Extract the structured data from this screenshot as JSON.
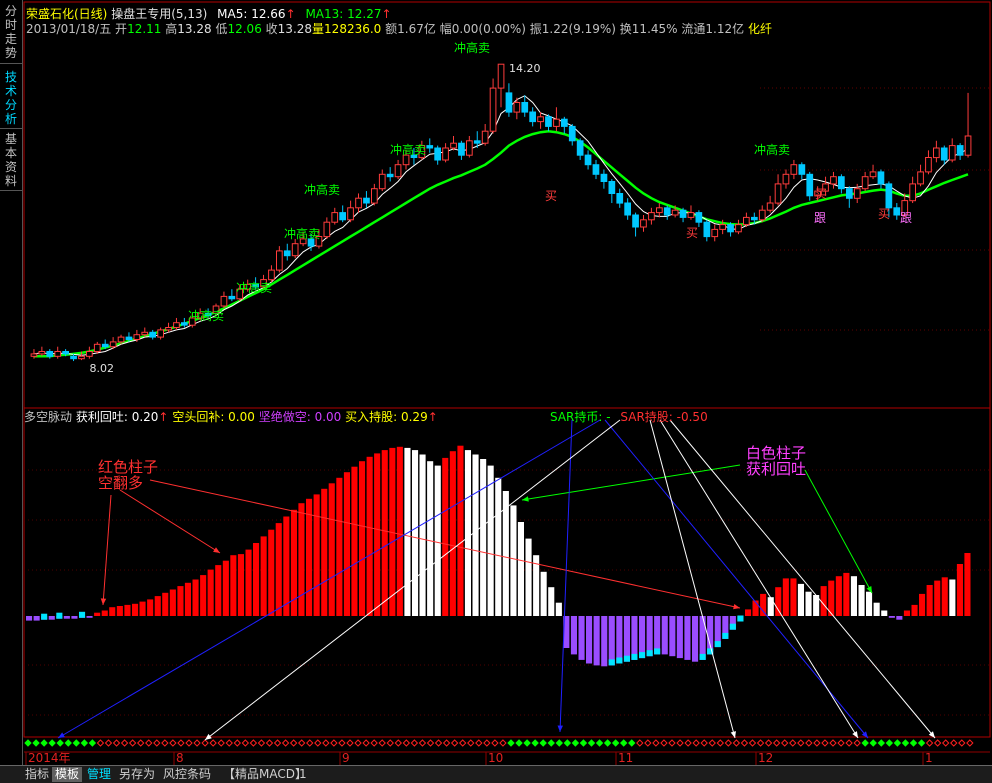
{
  "sidebar": {
    "tabs": [
      {
        "chars": [
          "分",
          "时",
          "走",
          "势"
        ],
        "active": false
      },
      {
        "chars": [
          "技",
          "术",
          "分",
          "析"
        ],
        "active": true
      },
      {
        "chars": [
          "基",
          "本",
          "资",
          "料"
        ],
        "active": false
      }
    ]
  },
  "header": {
    "stock": "荣盛石化(日线)",
    "strategy": "操盘王专用",
    "params": "(5,13)",
    "ma5": "MA5: 12.66",
    "ma13": "MA13: 12.27",
    "arrow": "↑"
  },
  "quote": {
    "date": "2013/01/18/五",
    "open_label": "开",
    "open": "12.11",
    "high_label": "高",
    "high": "13.28",
    "low_label": "低",
    "low": "12.06",
    "close_label": "收",
    "close": "13.28",
    "vol_label": "量",
    "vol": "128236.0",
    "amount": "额1.67亿",
    "change": "幅0.00(0.00%)",
    "amplitude": "振1.22(9.19%)",
    "turnover": "换11.45%",
    "float": "流通1.12亿",
    "industry": "化纤"
  },
  "indicator": {
    "name": "多空脉动",
    "profit_back": "获利回吐: 0.20",
    "short_cover": "空头回补: 0.00",
    "short_sell": "坚绝做空: 0.00",
    "buy_hold": "买入持股: 0.29",
    "arrow": "↑",
    "sar_coin": "SAR持币: -",
    "sar_hold": "SAR持股: -0.50"
  },
  "annotations": {
    "red_bar_line1": "红色柱子",
    "red_bar_line2": "空翻多",
    "white_bar_line1": "白色柱子",
    "white_bar_line2": "获利回吐"
  },
  "bottom_tabs": [
    "指标",
    "模板",
    "管理",
    "另存为",
    "风控条码",
    "【精品MACD】",
    "1"
  ],
  "colors": {
    "up": "#ff3c3c",
    "down": "#00c8ff",
    "ma5": "#ffffff",
    "ma13": "#00ff00",
    "signal_sell": "#00ff00",
    "signal_buy": "#ff3c3c",
    "axis": "#b00000",
    "hist_red": "#ff0000",
    "hist_white": "#ffffff",
    "hist_violet": "#9a4dff",
    "hist_cyan": "#00e5ff"
  },
  "chart_data": {
    "type": "candlestick+histogram",
    "price_ylim": [
      7.5,
      14.6
    ],
    "date_labels": [
      "2014年",
      "8",
      "9",
      "10",
      "11",
      "12",
      "1"
    ],
    "price_labels": [
      {
        "text": "14.20",
        "value": 14.2
      },
      {
        "text": "8.02",
        "value": 8.02
      }
    ],
    "candles": [
      [
        8.1,
        8.15,
        8.25,
        8.05
      ],
      [
        8.15,
        8.2,
        8.3,
        8.1
      ],
      [
        8.2,
        8.1,
        8.25,
        8.05
      ],
      [
        8.1,
        8.2,
        8.3,
        8.05
      ],
      [
        8.2,
        8.15,
        8.25,
        8.1
      ],
      [
        8.1,
        8.05,
        8.15,
        8.0
      ],
      [
        8.05,
        8.1,
        8.2,
        8.02
      ],
      [
        8.1,
        8.2,
        8.3,
        8.05
      ],
      [
        8.2,
        8.35,
        8.4,
        8.15
      ],
      [
        8.35,
        8.3,
        8.45,
        8.25
      ],
      [
        8.3,
        8.4,
        8.5,
        8.25
      ],
      [
        8.4,
        8.5,
        8.55,
        8.35
      ],
      [
        8.5,
        8.45,
        8.6,
        8.4
      ],
      [
        8.45,
        8.55,
        8.65,
        8.4
      ],
      [
        8.55,
        8.6,
        8.7,
        8.5
      ],
      [
        8.6,
        8.5,
        8.65,
        8.45
      ],
      [
        8.5,
        8.65,
        8.7,
        8.45
      ],
      [
        8.65,
        8.7,
        8.8,
        8.6
      ],
      [
        8.7,
        8.8,
        8.9,
        8.65
      ],
      [
        8.8,
        8.75,
        8.9,
        8.7
      ],
      [
        8.75,
        8.9,
        9.0,
        8.7
      ],
      [
        8.9,
        9.0,
        9.1,
        8.85
      ],
      [
        9.0,
        8.95,
        9.1,
        8.9
      ],
      [
        9.0,
        9.15,
        9.2,
        8.95
      ],
      [
        9.15,
        9.35,
        9.45,
        9.1
      ],
      [
        9.35,
        9.3,
        9.5,
        9.25
      ],
      [
        9.3,
        9.5,
        9.6,
        9.25
      ],
      [
        9.5,
        9.6,
        9.7,
        9.45
      ],
      [
        9.6,
        9.55,
        9.75,
        9.5
      ],
      [
        9.55,
        9.7,
        9.8,
        9.5
      ],
      [
        9.7,
        9.9,
        10.0,
        9.65
      ],
      [
        9.9,
        10.3,
        10.4,
        9.85
      ],
      [
        10.3,
        10.2,
        10.45,
        10.1
      ],
      [
        10.2,
        10.45,
        10.55,
        10.15
      ],
      [
        10.45,
        10.55,
        10.7,
        10.4
      ],
      [
        10.55,
        10.4,
        10.65,
        10.3
      ],
      [
        10.4,
        10.6,
        10.75,
        10.35
      ],
      [
        10.6,
        10.9,
        11.0,
        10.55
      ],
      [
        10.9,
        11.1,
        11.2,
        10.85
      ],
      [
        11.1,
        10.95,
        11.25,
        10.9
      ],
      [
        10.95,
        11.2,
        11.35,
        10.9
      ],
      [
        11.2,
        11.4,
        11.5,
        11.1
      ],
      [
        11.4,
        11.3,
        11.55,
        11.2
      ],
      [
        11.3,
        11.6,
        11.7,
        11.25
      ],
      [
        11.6,
        11.9,
        12.0,
        11.55
      ],
      [
        11.9,
        11.85,
        12.05,
        11.75
      ],
      [
        11.85,
        12.1,
        12.2,
        11.8
      ],
      [
        12.1,
        12.3,
        12.4,
        12.0
      ],
      [
        12.3,
        12.25,
        12.45,
        12.1
      ],
      [
        12.25,
        12.5,
        12.6,
        12.2
      ],
      [
        12.5,
        12.45,
        12.65,
        12.35
      ],
      [
        12.45,
        12.2,
        12.5,
        12.1
      ],
      [
        12.2,
        12.45,
        12.55,
        12.15
      ],
      [
        12.45,
        12.55,
        12.7,
        12.4
      ],
      [
        12.55,
        12.3,
        12.6,
        12.2
      ],
      [
        12.3,
        12.6,
        12.7,
        12.25
      ],
      [
        12.6,
        12.55,
        12.8,
        12.45
      ],
      [
        12.55,
        12.8,
        12.95,
        12.5
      ],
      [
        12.8,
        13.7,
        13.9,
        12.75
      ],
      [
        13.7,
        14.2,
        14.2,
        13.3
      ],
      [
        13.6,
        13.2,
        13.8,
        13.1
      ],
      [
        13.2,
        13.4,
        13.5,
        13.05
      ],
      [
        13.4,
        13.2,
        13.55,
        13.1
      ],
      [
        13.2,
        13.0,
        13.3,
        12.9
      ],
      [
        13.0,
        13.1,
        13.2,
        12.85
      ],
      [
        13.1,
        12.9,
        13.15,
        12.8
      ],
      [
        12.9,
        13.05,
        13.3,
        12.8
      ],
      [
        13.05,
        12.9,
        13.1,
        12.75
      ],
      [
        12.9,
        12.6,
        12.95,
        12.5
      ],
      [
        12.6,
        12.3,
        12.65,
        12.2
      ],
      [
        12.3,
        12.1,
        12.4,
        12.0
      ],
      [
        12.1,
        11.9,
        12.2,
        11.8
      ],
      [
        11.9,
        11.75,
        12.0,
        11.6
      ],
      [
        11.75,
        11.5,
        11.8,
        11.3
      ],
      [
        11.5,
        11.3,
        11.6,
        11.2
      ],
      [
        11.3,
        11.05,
        11.4,
        10.95
      ],
      [
        11.05,
        10.8,
        11.1,
        10.6
      ],
      [
        10.8,
        10.95,
        11.05,
        10.7
      ],
      [
        10.95,
        11.1,
        11.2,
        10.85
      ],
      [
        11.1,
        11.2,
        11.3,
        11.0
      ],
      [
        11.2,
        11.05,
        11.25,
        10.95
      ],
      [
        11.05,
        11.15,
        11.25,
        11.0
      ],
      [
        11.15,
        11.0,
        11.2,
        10.9
      ],
      [
        11.0,
        11.1,
        11.25,
        10.95
      ],
      [
        11.1,
        10.9,
        11.15,
        10.8
      ],
      [
        10.9,
        10.6,
        10.95,
        10.5
      ],
      [
        10.6,
        10.75,
        10.85,
        10.5
      ],
      [
        10.75,
        10.85,
        10.95,
        10.65
      ],
      [
        10.85,
        10.7,
        10.9,
        10.6
      ],
      [
        10.7,
        10.85,
        10.95,
        10.65
      ],
      [
        10.85,
        11.0,
        11.1,
        10.8
      ],
      [
        11.0,
        10.95,
        11.1,
        10.85
      ],
      [
        10.95,
        11.15,
        11.25,
        10.9
      ],
      [
        11.15,
        11.3,
        11.45,
        11.1
      ],
      [
        11.3,
        11.7,
        11.9,
        11.25
      ],
      [
        11.7,
        11.9,
        12.0,
        11.6
      ],
      [
        11.9,
        12.1,
        12.2,
        11.8
      ],
      [
        12.1,
        11.9,
        12.15,
        11.8
      ],
      [
        11.9,
        11.45,
        11.95,
        11.35
      ],
      [
        11.45,
        11.55,
        11.65,
        11.35
      ],
      [
        11.55,
        11.7,
        11.85,
        11.45
      ],
      [
        11.7,
        11.85,
        11.95,
        11.6
      ],
      [
        11.85,
        11.6,
        11.9,
        11.5
      ],
      [
        11.6,
        11.4,
        11.65,
        11.2
      ],
      [
        11.4,
        11.6,
        11.7,
        11.3
      ],
      [
        11.6,
        11.85,
        11.95,
        11.55
      ],
      [
        11.85,
        11.95,
        12.1,
        11.8
      ],
      [
        11.95,
        11.7,
        12.0,
        11.6
      ],
      [
        11.7,
        11.2,
        11.75,
        11.0
      ],
      [
        11.2,
        11.05,
        11.3,
        10.95
      ],
      [
        11.05,
        11.35,
        11.5,
        11.0
      ],
      [
        11.35,
        11.7,
        11.85,
        11.3
      ],
      [
        11.7,
        11.95,
        12.1,
        11.65
      ],
      [
        11.95,
        12.25,
        12.4,
        11.9
      ],
      [
        12.25,
        12.45,
        12.6,
        12.15
      ],
      [
        12.45,
        12.2,
        12.5,
        12.1
      ],
      [
        12.2,
        12.5,
        12.65,
        12.15
      ],
      [
        12.5,
        12.3,
        12.55,
        12.2
      ],
      [
        12.3,
        12.7,
        13.6,
        12.25
      ]
    ],
    "ma13_line": [
      8.1,
      8.1,
      8.1,
      8.12,
      8.13,
      8.15,
      8.17,
      8.2,
      8.24,
      8.28,
      8.32,
      8.37,
      8.42,
      8.47,
      8.52,
      8.57,
      8.62,
      8.67,
      8.72,
      8.78,
      8.84,
      8.9,
      8.96,
      9.03,
      9.1,
      9.18,
      9.26,
      9.34,
      9.42,
      9.5,
      9.6,
      9.7,
      9.8,
      9.9,
      10.0,
      10.1,
      10.2,
      10.3,
      10.4,
      10.5,
      10.6,
      10.7,
      10.8,
      10.9,
      11.0,
      11.1,
      11.2,
      11.3,
      11.4,
      11.5,
      11.6,
      11.68,
      11.75,
      11.82,
      11.88,
      11.95,
      12.02,
      12.1,
      12.22,
      12.35,
      12.5,
      12.6,
      12.68,
      12.74,
      12.78,
      12.8,
      12.78,
      12.74,
      12.68,
      12.58,
      12.46,
      12.32,
      12.18,
      12.04,
      11.9,
      11.76,
      11.62,
      11.5,
      11.4,
      11.32,
      11.26,
      11.2,
      11.14,
      11.08,
      11.02,
      10.96,
      10.92,
      10.88,
      10.86,
      10.85,
      10.86,
      10.88,
      10.92,
      10.98,
      11.05,
      11.12,
      11.2,
      11.26,
      11.3,
      11.34,
      11.38,
      11.42,
      11.46,
      11.48,
      11.5,
      11.53,
      11.56,
      11.58,
      11.56,
      11.5,
      11.45,
      11.45,
      11.5,
      11.58,
      11.65,
      11.72,
      11.78,
      11.84,
      11.9
    ],
    "histogram_ylim": [
      -0.7,
      1.7
    ],
    "histogram": [
      -0.05,
      -0.05,
      -0.04,
      -0.04,
      -0.03,
      -0.03,
      -0.03,
      -0.02,
      -0.02,
      0.03,
      0.05,
      0.08,
      0.09,
      0.1,
      0.11,
      0.13,
      0.15,
      0.18,
      0.21,
      0.24,
      0.27,
      0.3,
      0.33,
      0.37,
      0.42,
      0.46,
      0.5,
      0.55,
      0.56,
      0.6,
      0.66,
      0.72,
      0.78,
      0.84,
      0.9,
      0.96,
      1.02,
      1.06,
      1.1,
      1.15,
      1.2,
      1.25,
      1.3,
      1.35,
      1.4,
      1.44,
      1.47,
      1.5,
      1.52,
      1.53,
      1.52,
      1.5,
      1.46,
      1.4,
      1.36,
      1.43,
      1.49,
      1.54,
      1.5,
      1.46,
      1.42,
      1.36,
      1.25,
      1.13,
      1.0,
      0.85,
      0.7,
      0.55,
      0.4,
      0.26,
      0.12,
      -0.35,
      -0.42,
      -0.48,
      -0.52,
      -0.54,
      -0.55,
      -0.54,
      -0.52,
      -0.5,
      -0.48,
      -0.46,
      -0.44,
      -0.42,
      -0.42,
      -0.44,
      -0.46,
      -0.48,
      -0.5,
      -0.48,
      -0.42,
      -0.34,
      -0.25,
      -0.15,
      -0.06,
      0.06,
      0.14,
      0.2,
      0.17,
      0.26,
      0.34,
      0.34,
      0.29,
      0.22,
      0.19,
      0.27,
      0.32,
      0.36,
      0.39,
      0.36,
      0.28,
      0.22,
      0.12,
      0.05,
      -0.02,
      -0.04,
      0.05,
      0.1,
      0.2,
      0.28,
      0.32,
      0.35,
      0.33,
      0.47,
      0.57
    ],
    "histogram_colors": "red=rising positive, white=falling positive (profit taking), violet=negative, cyan=negative rising"
  }
}
